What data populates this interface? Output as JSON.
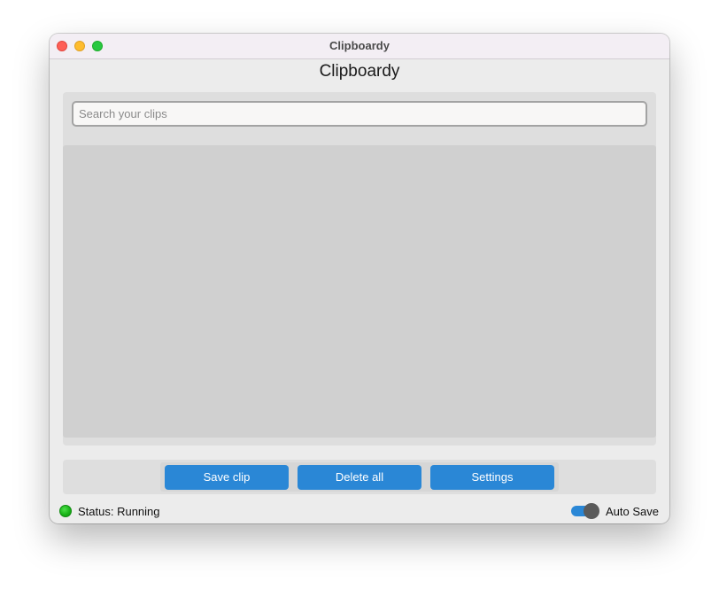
{
  "window": {
    "title": "Clipboardy"
  },
  "app": {
    "title": "Clipboardy"
  },
  "search": {
    "placeholder": "Search your clips",
    "value": ""
  },
  "clips": [],
  "toolbar": {
    "save_label": "Save clip",
    "delete_label": "Delete all",
    "settings_label": "Settings"
  },
  "status": {
    "text": "Status: Running",
    "indicator_color": "#19b418"
  },
  "auto_save": {
    "label": "Auto Save",
    "enabled": true
  },
  "colors": {
    "accent": "#2a87d6"
  }
}
